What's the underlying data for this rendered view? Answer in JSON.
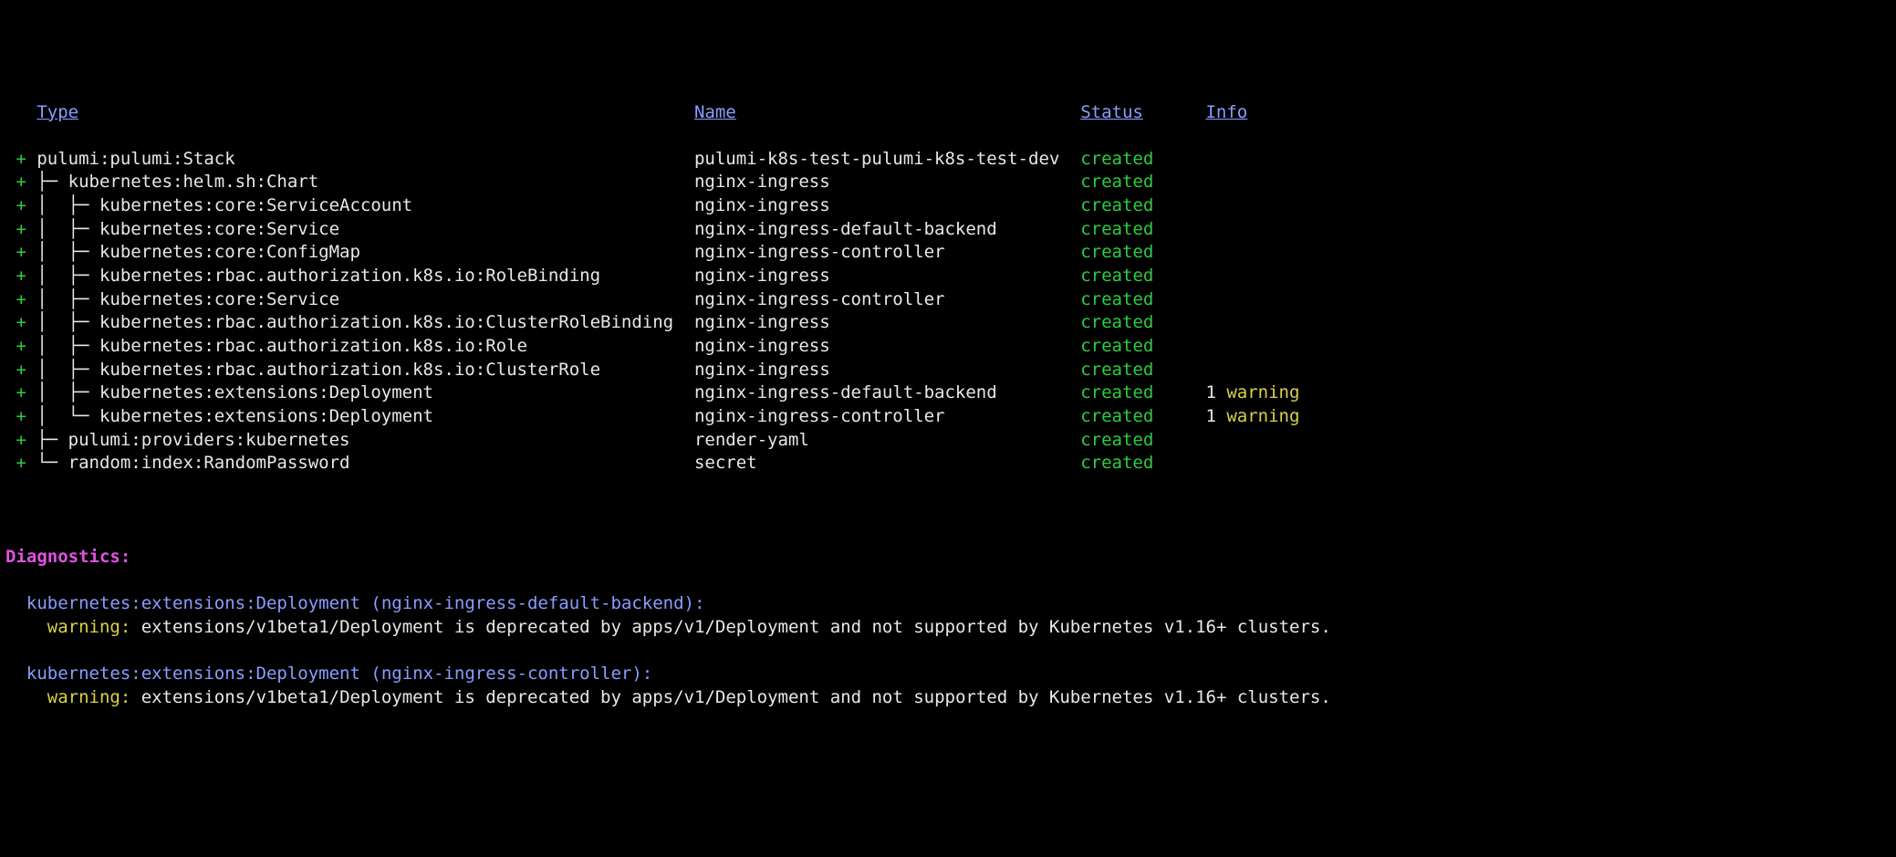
{
  "headers": {
    "type": "Type",
    "name": "Name",
    "status": "Status",
    "info": "Info"
  },
  "rows": [
    {
      "plus": "+",
      "prefix": "",
      "type": "pulumi:pulumi:Stack",
      "name": "pulumi-k8s-test-pulumi-k8s-test-dev",
      "status": "created",
      "info": ""
    },
    {
      "plus": "+",
      "prefix": "├─ ",
      "type": "kubernetes:helm.sh:Chart",
      "name": "nginx-ingress",
      "status": "created",
      "info": ""
    },
    {
      "plus": "+",
      "prefix": "│  ├─ ",
      "type": "kubernetes:core:ServiceAccount",
      "name": "nginx-ingress",
      "status": "created",
      "info": ""
    },
    {
      "plus": "+",
      "prefix": "│  ├─ ",
      "type": "kubernetes:core:Service",
      "name": "nginx-ingress-default-backend",
      "status": "created",
      "info": ""
    },
    {
      "plus": "+",
      "prefix": "│  ├─ ",
      "type": "kubernetes:core:ConfigMap",
      "name": "nginx-ingress-controller",
      "status": "created",
      "info": ""
    },
    {
      "plus": "+",
      "prefix": "│  ├─ ",
      "type": "kubernetes:rbac.authorization.k8s.io:RoleBinding",
      "name": "nginx-ingress",
      "status": "created",
      "info": ""
    },
    {
      "plus": "+",
      "prefix": "│  ├─ ",
      "type": "kubernetes:core:Service",
      "name": "nginx-ingress-controller",
      "status": "created",
      "info": ""
    },
    {
      "plus": "+",
      "prefix": "│  ├─ ",
      "type": "kubernetes:rbac.authorization.k8s.io:ClusterRoleBinding",
      "name": "nginx-ingress",
      "status": "created",
      "info": ""
    },
    {
      "plus": "+",
      "prefix": "│  ├─ ",
      "type": "kubernetes:rbac.authorization.k8s.io:Role",
      "name": "nginx-ingress",
      "status": "created",
      "info": ""
    },
    {
      "plus": "+",
      "prefix": "│  ├─ ",
      "type": "kubernetes:rbac.authorization.k8s.io:ClusterRole",
      "name": "nginx-ingress",
      "status": "created",
      "info": ""
    },
    {
      "plus": "+",
      "prefix": "│  ├─ ",
      "type": "kubernetes:extensions:Deployment",
      "name": "nginx-ingress-default-backend",
      "status": "created",
      "info_num": "1",
      "info_word": "warning"
    },
    {
      "plus": "+",
      "prefix": "│  └─ ",
      "type": "kubernetes:extensions:Deployment",
      "name": "nginx-ingress-controller",
      "status": "created",
      "info_num": "1",
      "info_word": "warning"
    },
    {
      "plus": "+",
      "prefix": "├─ ",
      "type": "pulumi:providers:kubernetes",
      "name": "render-yaml",
      "status": "created",
      "info": ""
    },
    {
      "plus": "+",
      "prefix": "└─ ",
      "type": "random:index:RandomPassword",
      "name": "secret",
      "status": "created",
      "info": ""
    }
  ],
  "diagnostics": {
    "header": "Diagnostics:",
    "items": [
      {
        "resource": "kubernetes:extensions:Deployment (nginx-ingress-default-backend):",
        "label": "warning:",
        "msg": "extensions/v1beta1/Deployment is deprecated by apps/v1/Deployment and not supported by Kubernetes v1.16+ clusters."
      },
      {
        "resource": "kubernetes:extensions:Deployment (nginx-ingress-controller):",
        "label": "warning:",
        "msg": "extensions/v1beta1/Deployment is deprecated by apps/v1/Deployment and not supported by Kubernetes v1.16+ clusters."
      }
    ]
  }
}
